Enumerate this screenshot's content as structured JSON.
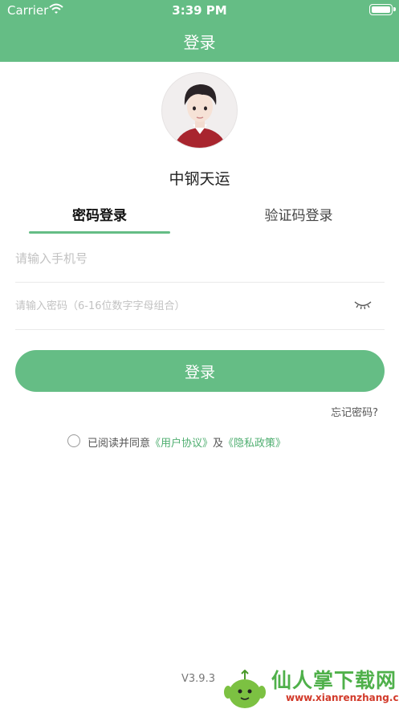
{
  "status_bar": {
    "carrier": "Carrier",
    "time": "3:39 PM"
  },
  "nav": {
    "title": "登录"
  },
  "profile": {
    "app_name": "中钢天运"
  },
  "tabs": [
    {
      "label": "密码登录",
      "active": true
    },
    {
      "label": "验证码登录",
      "active": false
    }
  ],
  "form": {
    "phone_placeholder": "请输入手机号",
    "password_placeholder": "请输入密码（6-16位数字字母组合）"
  },
  "login_button": "登录",
  "forgot_password": "忘记密码?",
  "agreement": {
    "prefix": "已阅读并同意",
    "user_agreement": "《用户协议》",
    "conjunction": "及",
    "privacy_policy": "《隐私政策》"
  },
  "version": "V3.9.3",
  "watermark": {
    "title": "仙人掌下载网",
    "url": "www.xianrenzhang.com"
  },
  "colors": {
    "brand_green": "#65bd85",
    "link_green": "#4fae70"
  },
  "icons": {
    "wifi": "wifi-icon",
    "battery": "battery-icon",
    "eye": "eye-closed-icon"
  }
}
